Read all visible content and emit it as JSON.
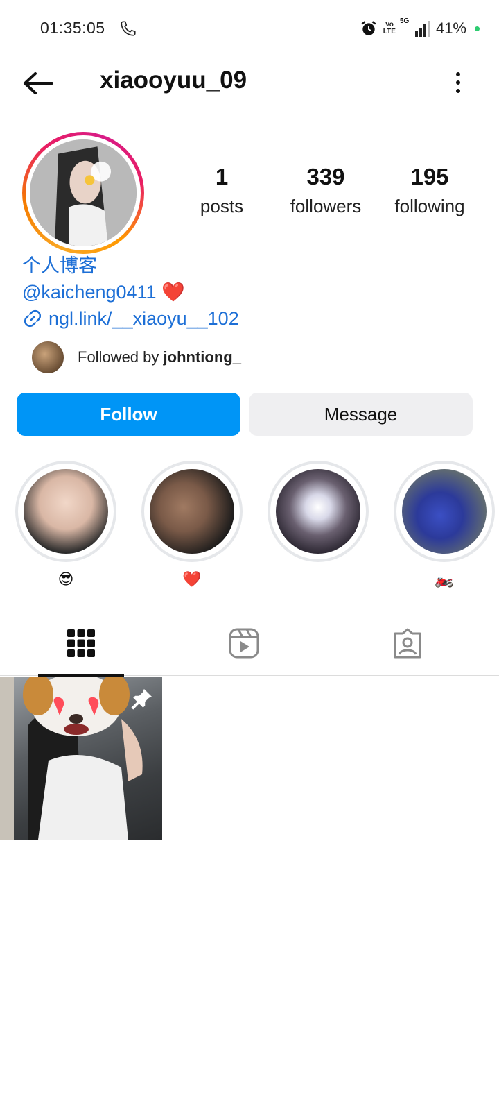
{
  "status_bar": {
    "time": "01:35:05",
    "battery": "41%",
    "network": "5G",
    "volte_top": "Vo",
    "volte_bottom": "LTE"
  },
  "header": {
    "username": "xiaooyuu_09"
  },
  "stats": [
    {
      "value": "1",
      "label": "posts"
    },
    {
      "value": "339",
      "label": "followers"
    },
    {
      "value": "195",
      "label": "following"
    }
  ],
  "bio": {
    "line1": "个人博客",
    "line2": "@kaicheng0411 ❤️",
    "link": "ngl.link/__xiaoyu__102"
  },
  "followed_by": {
    "prefix": "Followed by ",
    "user": "johntiong_"
  },
  "buttons": {
    "follow": "Follow",
    "message": "Message"
  },
  "highlights": [
    {
      "label": "😎",
      "colors": [
        "#f1d7c8",
        "#2b2b2b"
      ]
    },
    {
      "label": "❤️",
      "colors": [
        "#7a5a48",
        "#1a1a1a"
      ]
    },
    {
      "label": "",
      "colors": [
        "#d8d8e8",
        "#2a2530"
      ]
    },
    {
      "label": "🏍️",
      "colors": [
        "#3b4fc4",
        "#5f6a72"
      ]
    }
  ],
  "tabs": [
    "grid-icon",
    "reels-icon",
    "tagged-icon"
  ],
  "colors": {
    "follow_button": "#0095f6",
    "link": "#1d6fd6",
    "battery_dot": "#2ecc71"
  }
}
